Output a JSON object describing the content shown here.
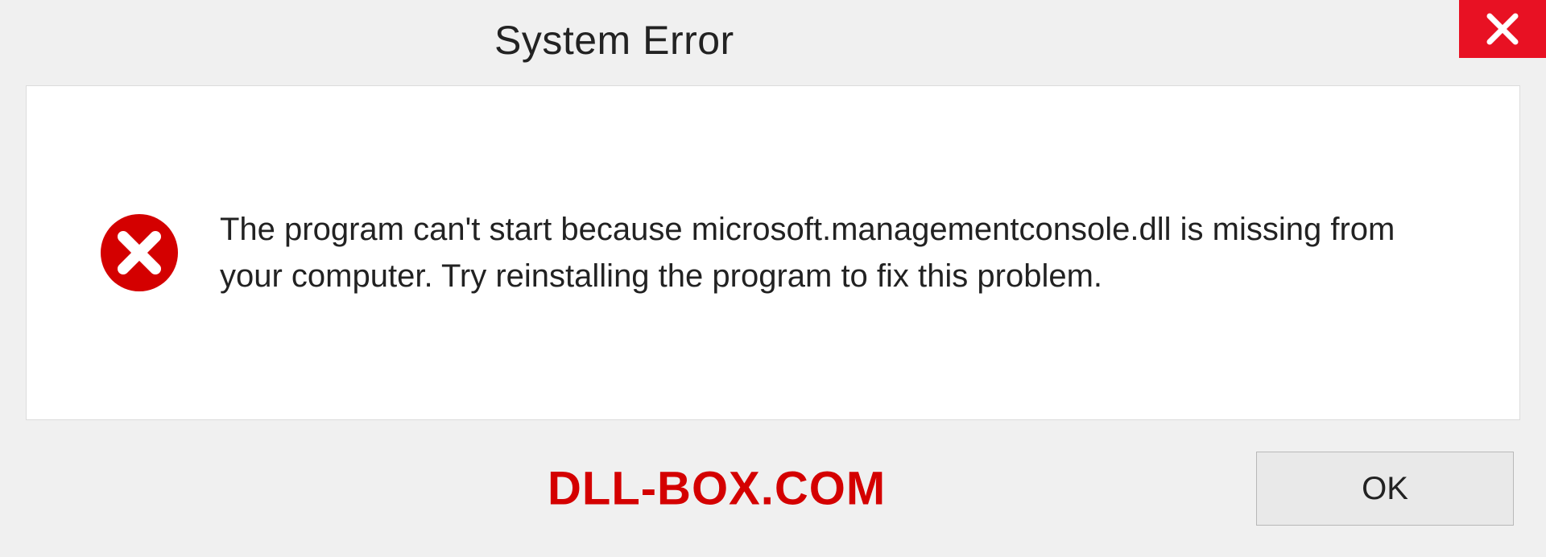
{
  "titlebar": {
    "title": "System Error"
  },
  "content": {
    "message": "The program can't start because microsoft.managementconsole.dll is missing from your computer. Try reinstalling the program to fix this problem."
  },
  "footer": {
    "watermark": "DLL-BOX.COM",
    "ok_label": "OK"
  },
  "colors": {
    "close_button_bg": "#e81123",
    "error_icon_bg": "#d40000",
    "watermark_color": "#d40000"
  }
}
